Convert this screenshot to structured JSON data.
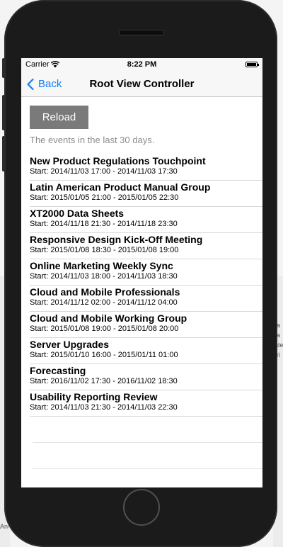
{
  "background": {
    "right_text": [
      "-a",
      "-a",
      "ate",
      "-ri"
    ],
    "left_text": "Anc"
  },
  "status_bar": {
    "carrier": "Carrier",
    "time": "8:22 PM"
  },
  "nav": {
    "back_label": "Back",
    "title": "Root View Controller"
  },
  "reload_label": "Reload",
  "caption": "The events in the last 30 days.",
  "events": [
    {
      "title": "New Product Regulations Touchpoint",
      "time": "Start: 2014/11/03 17:00 - 2014/11/03 17:30"
    },
    {
      "title": "Latin American Product Manual Group",
      "time": "Start: 2015/01/05 21:00 - 2015/01/05 22:30"
    },
    {
      "title": "XT2000 Data Sheets",
      "time": "Start: 2014/11/18 21:30 - 2014/11/18 23:30"
    },
    {
      "title": "Responsive Design Kick-Off Meeting",
      "time": "Start: 2015/01/08 18:30 - 2015/01/08 19:00"
    },
    {
      "title": "Online Marketing Weekly Sync",
      "time": "Start: 2014/11/03 18:00 - 2014/11/03 18:30"
    },
    {
      "title": "Cloud and Mobile Professionals",
      "time": "Start: 2014/11/12 02:00 - 2014/11/12 04:00"
    },
    {
      "title": "Cloud and Mobile Working Group",
      "time": "Start: 2015/01/08 19:00 - 2015/01/08 20:00"
    },
    {
      "title": "Server Upgrades",
      "time": "Start: 2015/01/10 16:00 - 2015/01/11 01:00"
    },
    {
      "title": "Forecasting",
      "time": "Start: 2016/11/02 17:30 - 2016/11/02 18:30"
    },
    {
      "title": "Usability Reporting Review",
      "time": "Start: 2014/11/03 21:30 - 2014/11/03 22:30"
    }
  ],
  "colors": {
    "accent": "#157efb",
    "reload_bg": "#7a7a7a"
  }
}
